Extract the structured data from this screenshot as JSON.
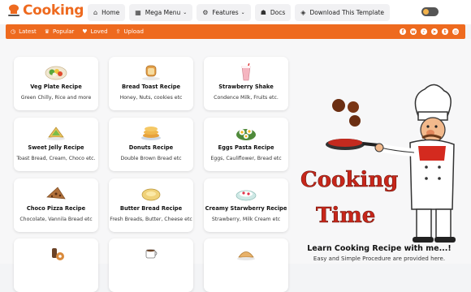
{
  "header": {
    "logo_text": "Cooking",
    "nav": [
      {
        "icon": "home-icon",
        "label": "Home"
      },
      {
        "icon": "grid-icon",
        "label": "Mega Menu"
      },
      {
        "icon": "gear-icon",
        "label": "Features"
      },
      {
        "icon": "doc-icon",
        "label": "Docs"
      },
      {
        "icon": "download-icon",
        "label": "Download This Template"
      }
    ]
  },
  "subnav": {
    "links": [
      {
        "icon": "clock-icon",
        "label": "Latest"
      },
      {
        "icon": "trophy-icon",
        "label": "Popular"
      },
      {
        "icon": "heart-icon",
        "label": "Loved"
      },
      {
        "icon": "upload-icon",
        "label": "Upload"
      }
    ],
    "social": [
      "facebook-icon",
      "whatsapp-icon",
      "tiktok-icon",
      "telegram-icon",
      "twitter-icon",
      "instagram-icon"
    ]
  },
  "cards": [
    {
      "title": "Veg Plate Recipe",
      "sub": "Green Chilly, Rice and more"
    },
    {
      "title": "Bread Toast Recipe",
      "sub": "Honey, Nuts, cookies etc"
    },
    {
      "title": "Strawberry Shake",
      "sub": "Condence Milk, Fruits etc."
    },
    {
      "title": "Sweet Jelly Recipe",
      "sub": "Toast Bread, Cream, Choco etc."
    },
    {
      "title": "Donuts Recipe",
      "sub": "Double Brown Bread etc"
    },
    {
      "title": "Eggs Pasta Recipe",
      "sub": "Eggs, Cauliflower, Bread etc"
    },
    {
      "title": "Choco Pizza Recipe",
      "sub": "Chocolate, Vannila Bread etc"
    },
    {
      "title": "Butter Bread Recipe",
      "sub": "Fresh Breads, Butter, Cheese etc"
    },
    {
      "title": "Creamy Starwberry Recipe",
      "sub": "Strawberry, Milk Cream etc"
    },
    {
      "title": "",
      "sub": ""
    },
    {
      "title": "",
      "sub": ""
    },
    {
      "title": "",
      "sub": ""
    }
  ],
  "promo": {
    "art_text_1": "Cooking",
    "art_text_2": "Time",
    "title": "Learn Cooking Recipe with me...!",
    "subtitle": "Easy and Simple Procedure are provided here."
  },
  "colors": {
    "accent": "#ee6a1f"
  }
}
